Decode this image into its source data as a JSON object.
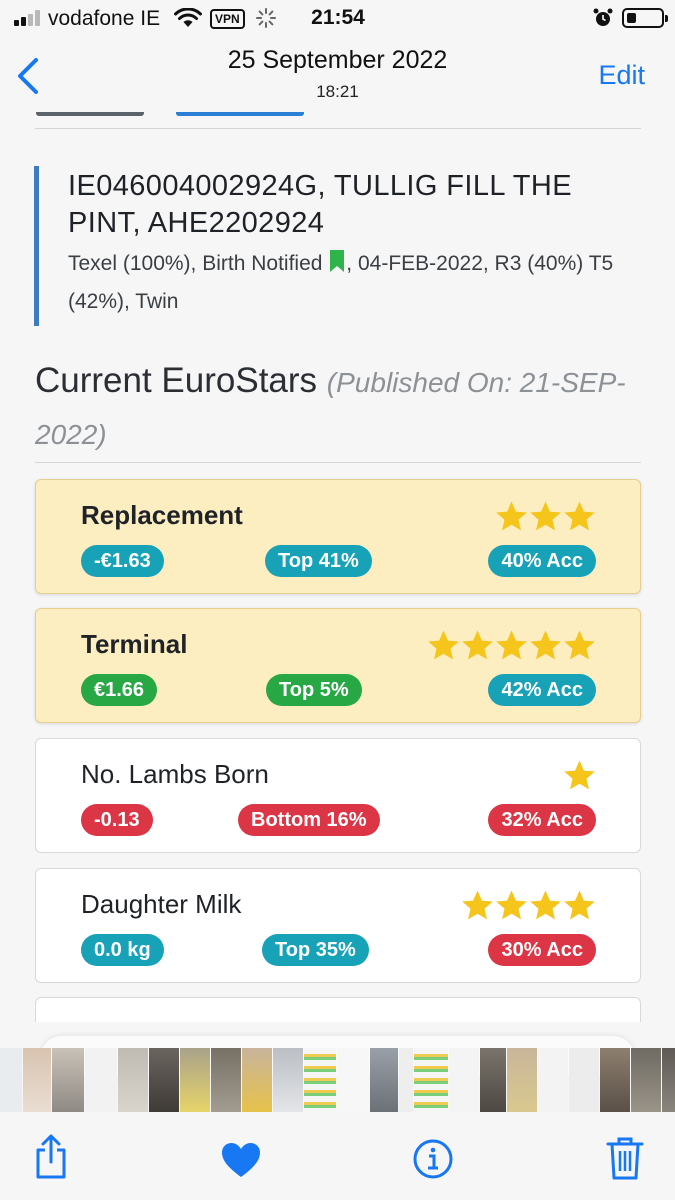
{
  "status_bar": {
    "carrier": "vodafone IE",
    "vpn": "VPN",
    "time": "21:54"
  },
  "nav": {
    "date": "25 September 2022",
    "time": "18:21",
    "edit_label": "Edit"
  },
  "animal": {
    "title": "IE046004002924G, TULLIG FILL THE PINT, AHE2202924",
    "meta_part1": "Texel (100%), Birth Notified",
    "meta_part2": ", 04-FEB-2022, R3 (40%) T5 (42%), Twin"
  },
  "section": {
    "title": "Current EuroStars",
    "published": "(Published On: 21-SEP-2022)"
  },
  "cards": [
    {
      "title": "Replacement",
      "stars": 3,
      "value": "-€1.63",
      "rank": "Top 41%",
      "accuracy": "40% Acc"
    },
    {
      "title": "Terminal",
      "stars": 5,
      "value": "€1.66",
      "rank": "Top 5%",
      "accuracy": "42% Acc"
    },
    {
      "title": "No. Lambs Born",
      "stars": 1,
      "value": "-0.13",
      "rank": "Bottom 16%",
      "accuracy": "32% Acc"
    },
    {
      "title": "Daughter Milk",
      "stars": 4,
      "value": "0.0 kg",
      "rank": "Top 35%",
      "accuracy": "30% Acc"
    }
  ],
  "colors": {
    "accent_blue": "#1877f2",
    "badge_teal": "#17a2b8",
    "badge_green": "#28a745",
    "badge_red": "#dc3545",
    "star": "#f6c51c",
    "highlight_card": "#fdeec2"
  },
  "icons": {
    "back": "chevron-left-icon",
    "share": "share-icon",
    "favorite": "heart-icon",
    "info": "info-icon",
    "delete": "trash-icon",
    "bookmark": "bookmark-icon",
    "star": "star-icon"
  }
}
